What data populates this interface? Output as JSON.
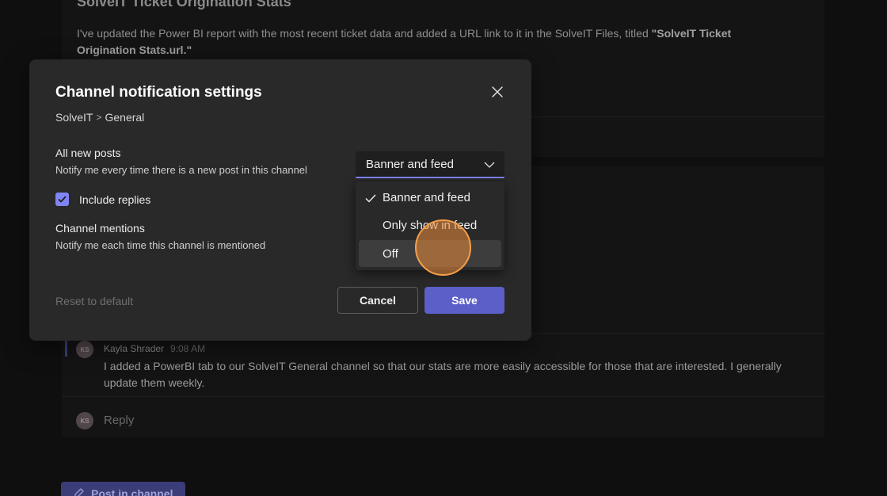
{
  "background": {
    "post": {
      "title": "SolveIT Ticket Origination Stats",
      "body_prefix": "I've updated the Power BI report with the most recent ticket data and added a URL link to it in the SolveIT Files, titled ",
      "body_bold": "\"SolveIT Ticket Origination Stats.url.\""
    },
    "message": {
      "avatar_initials": "KS",
      "author": "Kayla Shrader",
      "time": "9:08 AM",
      "text": "I added a PowerBI tab to our SolveIT General channel so that our stats are more easily accessible for those that are interested. I generally update them weekly."
    },
    "reply": {
      "avatar_initials": "KS",
      "label": "Reply"
    },
    "post_in_channel_label": "Post in channel"
  },
  "modal": {
    "title": "Channel notification settings",
    "breadcrumb": {
      "team": "SolveIT",
      "separator": ">",
      "channel": "General"
    },
    "all_new_posts": {
      "title": "All new posts",
      "description": "Notify me every time there is a new post in this channel"
    },
    "include_replies": {
      "label": "Include replies",
      "checked": true
    },
    "channel_mentions": {
      "title": "Channel mentions",
      "description": "Notify me each time this channel is mentioned"
    },
    "select": {
      "value": "Banner and feed"
    },
    "dropdown": {
      "options": [
        {
          "label": "Banner and feed",
          "selected": true
        },
        {
          "label": "Only show in feed",
          "selected": false
        },
        {
          "label": "Off",
          "selected": false,
          "hovered": true
        }
      ]
    },
    "reset_label": "Reset to default",
    "cancel_label": "Cancel",
    "save_label": "Save"
  },
  "colors": {
    "accent": "#5b5fc7",
    "accent_light": "#7f85f5",
    "modal_bg": "#292929",
    "cursor_highlight": "#f5a04a"
  }
}
